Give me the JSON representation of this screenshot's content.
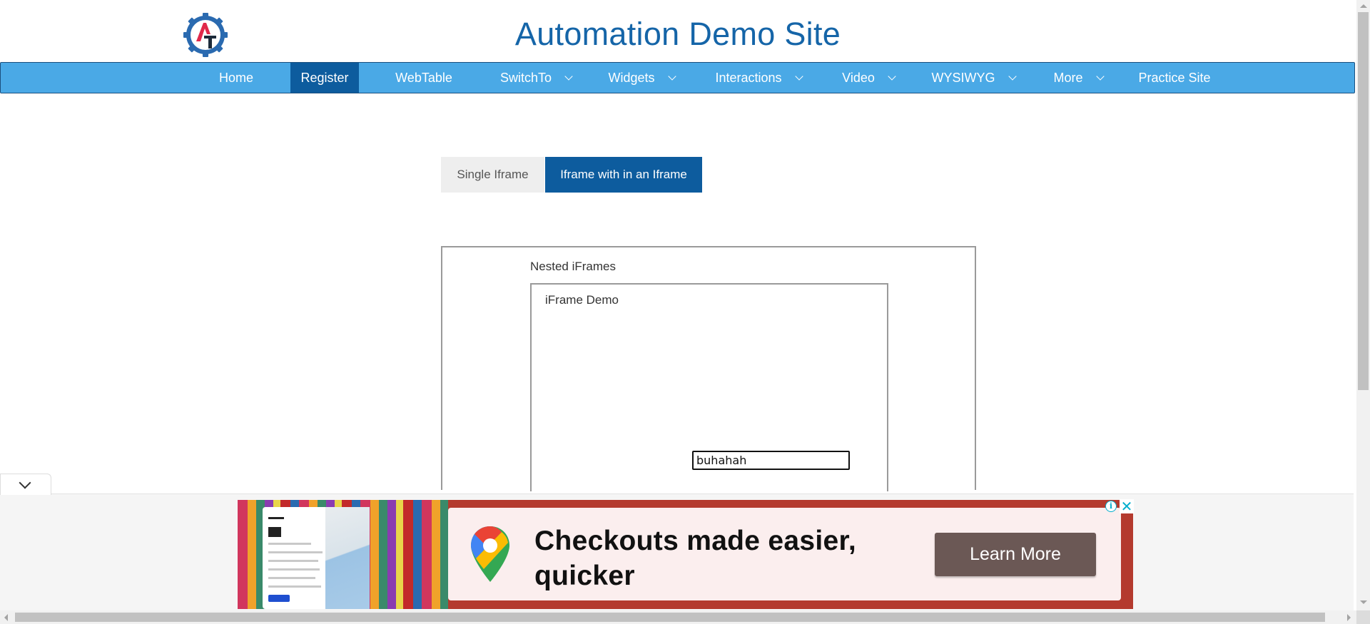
{
  "header": {
    "title": "Automation Demo Site",
    "logo_icon": "gear-logo-icon"
  },
  "nav": {
    "items": [
      {
        "label": "Home",
        "active": false,
        "dropdown": false
      },
      {
        "label": "Register",
        "active": true,
        "dropdown": false
      },
      {
        "label": "WebTable",
        "active": false,
        "dropdown": false
      },
      {
        "label": "SwitchTo",
        "active": false,
        "dropdown": true
      },
      {
        "label": "Widgets",
        "active": false,
        "dropdown": true
      },
      {
        "label": "Interactions",
        "active": false,
        "dropdown": true
      },
      {
        "label": "Video",
        "active": false,
        "dropdown": true
      },
      {
        "label": "WYSIWYG",
        "active": false,
        "dropdown": true
      },
      {
        "label": "More",
        "active": false,
        "dropdown": true
      },
      {
        "label": "Practice Site",
        "active": false,
        "dropdown": false
      }
    ]
  },
  "tabs": {
    "single": "Single Iframe",
    "nested": "Iframe with in an Iframe",
    "active": "nested"
  },
  "frames": {
    "outer_label": "Nested iFrames",
    "inner_label": "iFrame Demo",
    "input_value": "buhahah"
  },
  "ad": {
    "headline": "Checkouts made easier, quicker",
    "button": "Learn More",
    "info_icon": "info-icon",
    "close_icon": "close-icon"
  },
  "colors": {
    "title": "#1565a8",
    "nav_bg": "#4aa9e6",
    "nav_active": "#0d5c9e",
    "ad_bg": "#b43a2e",
    "ad_button": "#6b5855"
  }
}
